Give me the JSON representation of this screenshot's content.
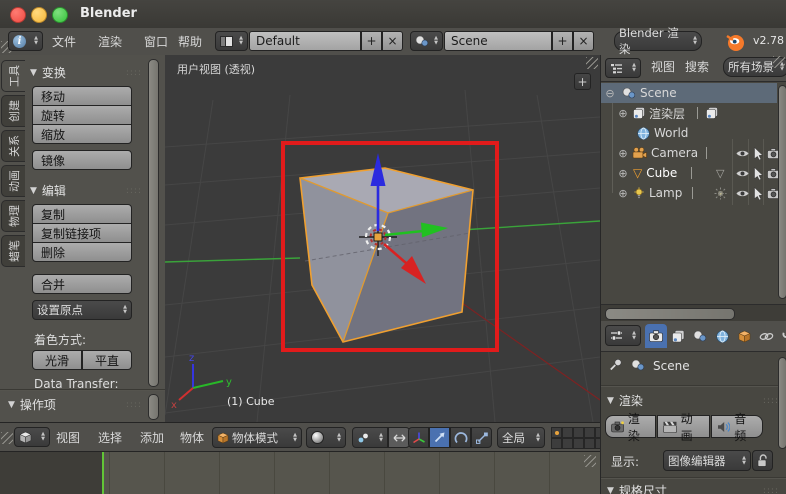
{
  "window": {
    "title": "Blender",
    "version": "v2.78"
  },
  "icons": {
    "up_arrow": "▲",
    "down_arrow": "▼",
    "panel_collapse": "▼",
    "expand": "⊕",
    "collapse": "⊖",
    "plus": "+",
    "close": "×",
    "grip": "::::",
    "mesh_triangle": "▽",
    "info_glyph": "i"
  },
  "menubar": {
    "menus": [
      "文件",
      "渲染",
      "窗口",
      "帮助"
    ],
    "layout_value": "Default",
    "scene_value": "Scene",
    "engine_value": "Blender 渲染"
  },
  "tool_shelf": {
    "tabs": [
      "工具",
      "创建",
      "关系",
      "动画",
      "物理",
      "蜡笔"
    ],
    "transform_panel": {
      "title": "变换",
      "buttons": [
        "移动",
        "旋转",
        "缩放",
        "镜像"
      ]
    },
    "edit_panel": {
      "title": "编辑",
      "buttons": [
        "复制",
        "复制链接项",
        "删除",
        "合并"
      ],
      "origin_dropdown": "设置原点",
      "shading_label": "着色方式:",
      "smooth_button": "光滑",
      "flat_button": "平直",
      "data_transfer_label": "Data Transfer:"
    },
    "operator_panel_title": "操作项"
  },
  "viewport": {
    "view_label": "用户视图 (透视)",
    "object_info": "(1) Cube",
    "axis_x": "x",
    "axis_y": "y",
    "axis_z": "z"
  },
  "viewport_header": {
    "menus": [
      "视图",
      "选择",
      "添加",
      "物体"
    ],
    "mode_value": "物体模式",
    "orientation_value": "全局"
  },
  "outliner": {
    "menus": [
      "视图",
      "搜索"
    ],
    "filter_value": "所有场景",
    "items": [
      {
        "name": "Scene"
      },
      {
        "name": "渲染层"
      },
      {
        "name": "World"
      },
      {
        "name": "Camera"
      },
      {
        "name": "Cube"
      },
      {
        "name": "Lamp"
      }
    ]
  },
  "properties": {
    "context_label": "Scene",
    "render_panel": {
      "title": "渲染",
      "render_button": "渲染",
      "animation_button": "动画",
      "audio_button": "音频",
      "display_label": "显示:",
      "display_value": "图像编辑器"
    },
    "dimensions_panel_title": "规格尺寸"
  },
  "colors": {
    "accent_blue": "#4a71b0",
    "selection_orange": "#f5a623",
    "annotation_red": "#e11b1b"
  }
}
